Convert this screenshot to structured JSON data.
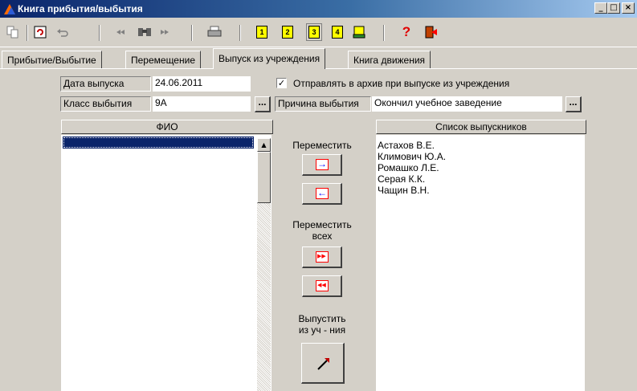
{
  "window": {
    "title": "Книга прибытия/выбытия",
    "controls": {
      "minimize": "_",
      "maximize": "□",
      "close": "×"
    }
  },
  "toolbar": {
    "pages": [
      "1",
      "2",
      "3",
      "4"
    ],
    "help_glyph": "?"
  },
  "tabs": [
    {
      "label": "Прибытие/Выбытие"
    },
    {
      "label": "Перемещение"
    },
    {
      "label": "Выпуск из учреждения"
    },
    {
      "label": "Книга движения"
    }
  ],
  "form": {
    "release_date_label": "Дата выпуска",
    "release_date_value": "24.06.2011",
    "archive_checkbox_label": "Отправлять в архив при выпуске из учреждения",
    "archive_checked": true,
    "check_glyph": "✓",
    "class_label": "Класс выбытия",
    "class_value": "9А",
    "reason_label": "Причина выбытия",
    "reason_value": "Окончил учебное заведение",
    "ellipsis": "..."
  },
  "lists": {
    "fio_header": "ФИО",
    "graduates_header": "Список выпускников",
    "graduates": [
      "Астахов В.Е.",
      "Климович Ю.А.",
      "Ромашко Л.Е.",
      "Серая К.К.",
      "Чащин В.Н."
    ]
  },
  "middle": {
    "move_label": "Переместить",
    "move_all_label_line1": "Переместить",
    "move_all_label_line2": "всех",
    "release_label_line1": "Выпустить",
    "release_label_line2": "из уч - ния",
    "arrow_right": "→",
    "arrow_left": "←",
    "arrow_all_right": "▶▶",
    "arrow_all_left": "◀◀"
  },
  "colors": {
    "selection": "#0a246a",
    "page_icon": "#ffff00",
    "arrow_border": "#ff0000",
    "arrow_glyph": "#0000ff"
  }
}
